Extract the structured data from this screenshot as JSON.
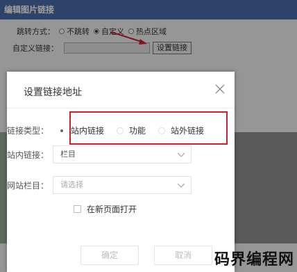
{
  "background_dialog": {
    "title": "编辑图片链接",
    "jump_label": "跳转方式：",
    "jump_options": [
      "不跳转",
      "自定义",
      "热点区域"
    ],
    "custom_link_label": "自定义链接：",
    "set_link_button": "设置链接"
  },
  "modal": {
    "title": "设置链接地址",
    "link_type_label": "链接类型：",
    "link_type_options": [
      "站内链接",
      "功能",
      "站外链接"
    ],
    "site_link_label": "站内链接：",
    "site_link_value": "栏目",
    "site_column_label": "网站栏目：",
    "site_column_placeholder": "请选择",
    "new_window_label": "在新页面打开",
    "confirm_button": "确定",
    "cancel_button": "取消"
  },
  "watermark": "码界编程网",
  "colors": {
    "titlebar": "#4a6fa8",
    "highlight": "#d02030"
  }
}
